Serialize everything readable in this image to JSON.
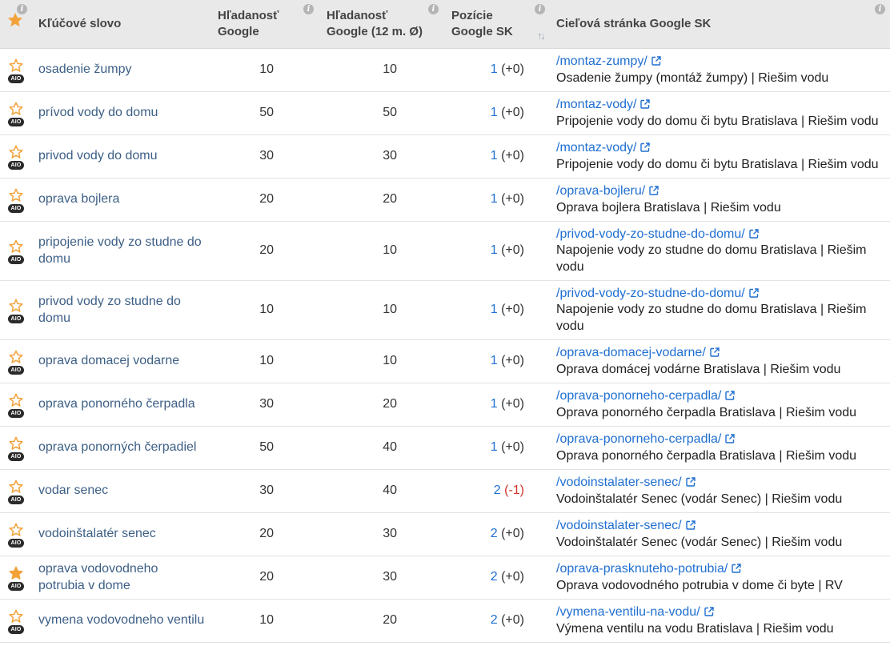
{
  "header": {
    "keyword": "Kľúčové slovo",
    "google_volume": [
      "Hľadanosť",
      "Google"
    ],
    "google_volume_12m": [
      "Hľadanosť",
      "Google (12 m. Ø)"
    ],
    "position": [
      "Pozície",
      "Google SK"
    ],
    "target_page": "Cieľová stránka Google SK",
    "info_glyph": "i",
    "sort_glyph": "↑↓"
  },
  "colors": {
    "star_outline": "#f3a23b",
    "star_filled": "#f3a23b",
    "link": "#1f6fd1",
    "keyword": "#3d5f86",
    "negative": "#d0342c"
  },
  "icons": [
    "star-icon",
    "aio-badge",
    "info-icon",
    "sort-icon",
    "external-link-icon"
  ],
  "aio_label": "AIO",
  "rows": [
    {
      "starred": false,
      "keyword": "osadenie žumpy",
      "volume": "10",
      "volume12": "10",
      "position": "1",
      "change": "(+0)",
      "change_negative": false,
      "url": "/montaz-zumpy/",
      "title": "Osadenie žumpy (montáž žumpy) | Riešim vodu"
    },
    {
      "starred": false,
      "keyword": "prívod vody do domu",
      "volume": "50",
      "volume12": "50",
      "position": "1",
      "change": "(+0)",
      "change_negative": false,
      "url": "/montaz-vody/",
      "title": "Pripojenie vody do domu či bytu Bratislava | Riešim vodu"
    },
    {
      "starred": false,
      "keyword": "privod vody do domu",
      "volume": "30",
      "volume12": "30",
      "position": "1",
      "change": "(+0)",
      "change_negative": false,
      "url": "/montaz-vody/",
      "title": "Pripojenie vody do domu či bytu Bratislava | Riešim vodu"
    },
    {
      "starred": false,
      "keyword": "oprava bojlera",
      "volume": "20",
      "volume12": "20",
      "position": "1",
      "change": "(+0)",
      "change_negative": false,
      "url": "/oprava-bojleru/",
      "title": "Oprava bojlera Bratislava | Riešim vodu"
    },
    {
      "starred": false,
      "keyword": "pripojenie vody zo studne do domu",
      "volume": "20",
      "volume12": "10",
      "position": "1",
      "change": "(+0)",
      "change_negative": false,
      "url": "/privod-vody-zo-studne-do-domu/",
      "title": "Napojenie vody zo studne do domu Bratislava | Riešim vodu"
    },
    {
      "starred": false,
      "keyword": "privod vody zo studne do domu",
      "volume": "10",
      "volume12": "10",
      "position": "1",
      "change": "(+0)",
      "change_negative": false,
      "url": "/privod-vody-zo-studne-do-domu/",
      "title": "Napojenie vody zo studne do domu Bratislava | Riešim vodu"
    },
    {
      "starred": false,
      "keyword": "oprava domacej vodarne",
      "volume": "10",
      "volume12": "10",
      "position": "1",
      "change": "(+0)",
      "change_negative": false,
      "url": "/oprava-domacej-vodarne/",
      "title": "Oprava domácej vodárne Bratislava | Riešim vodu"
    },
    {
      "starred": false,
      "keyword": "oprava ponorného čerpadla",
      "volume": "30",
      "volume12": "20",
      "position": "1",
      "change": "(+0)",
      "change_negative": false,
      "url": "/oprava-ponorneho-cerpadla/",
      "title": "Oprava ponorného čerpadla Bratislava | Riešim vodu"
    },
    {
      "starred": false,
      "keyword": "oprava ponorných čerpadiel",
      "volume": "50",
      "volume12": "40",
      "position": "1",
      "change": "(+0)",
      "change_negative": false,
      "url": "/oprava-ponorneho-cerpadla/",
      "title": "Oprava ponorného čerpadla Bratislava | Riešim vodu"
    },
    {
      "starred": false,
      "keyword": "vodar senec",
      "volume": "30",
      "volume12": "40",
      "position": "2",
      "change": "(-1)",
      "change_negative": true,
      "url": "/vodoinstalater-senec/",
      "title": "Vodoinštalatér Senec (vodár Senec) | Riešim vodu"
    },
    {
      "starred": false,
      "keyword": "vodoinštalatér senec",
      "volume": "20",
      "volume12": "30",
      "position": "2",
      "change": "(+0)",
      "change_negative": false,
      "url": "/vodoinstalater-senec/",
      "title": "Vodoinštalatér Senec (vodár Senec) | Riešim vodu"
    },
    {
      "starred": true,
      "keyword": "oprava vodovodneho potrubia v dome",
      "volume": "20",
      "volume12": "30",
      "position": "2",
      "change": "(+0)",
      "change_negative": false,
      "url": "/oprava-prasknuteho-potrubia/",
      "title": "Oprava vodovodného potrubia v dome či byte | RV"
    },
    {
      "starred": false,
      "keyword": "vymena vodovodneho ventilu",
      "volume": "10",
      "volume12": "20",
      "position": "2",
      "change": "(+0)",
      "change_negative": false,
      "url": "/vymena-ventilu-na-vodu/",
      "title": "Výmena ventilu na vodu Bratislava | Riešim vodu"
    }
  ]
}
